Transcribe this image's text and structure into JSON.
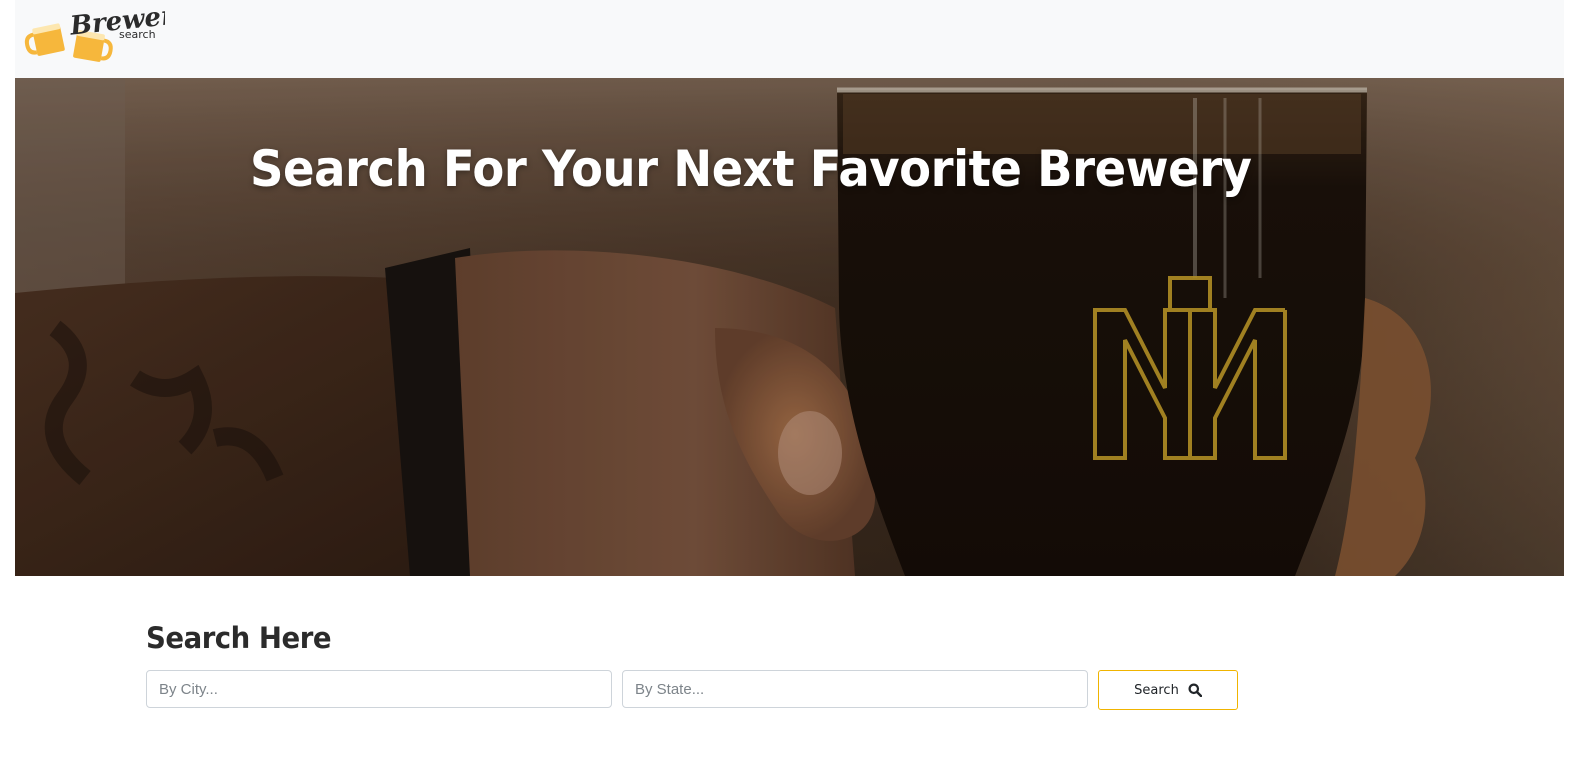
{
  "header": {
    "logo": {
      "word": "Brewery",
      "sub": "search",
      "icon": "beer-mugs-icon"
    }
  },
  "hero": {
    "title": "Search For Your Next Favorite Brewery",
    "image": "hand-holding-dark-beer-glass"
  },
  "search": {
    "heading": "Search Here",
    "city_placeholder": "By City...",
    "city_value": "",
    "state_placeholder": "By State...",
    "state_value": "",
    "button_label": "Search",
    "button_icon": "magnifier-icon"
  },
  "colors": {
    "accent": "#f0b400",
    "navbar_bg": "#f8f9fa",
    "heading_text": "#2b2b2b",
    "input_border": "#ced4da"
  }
}
